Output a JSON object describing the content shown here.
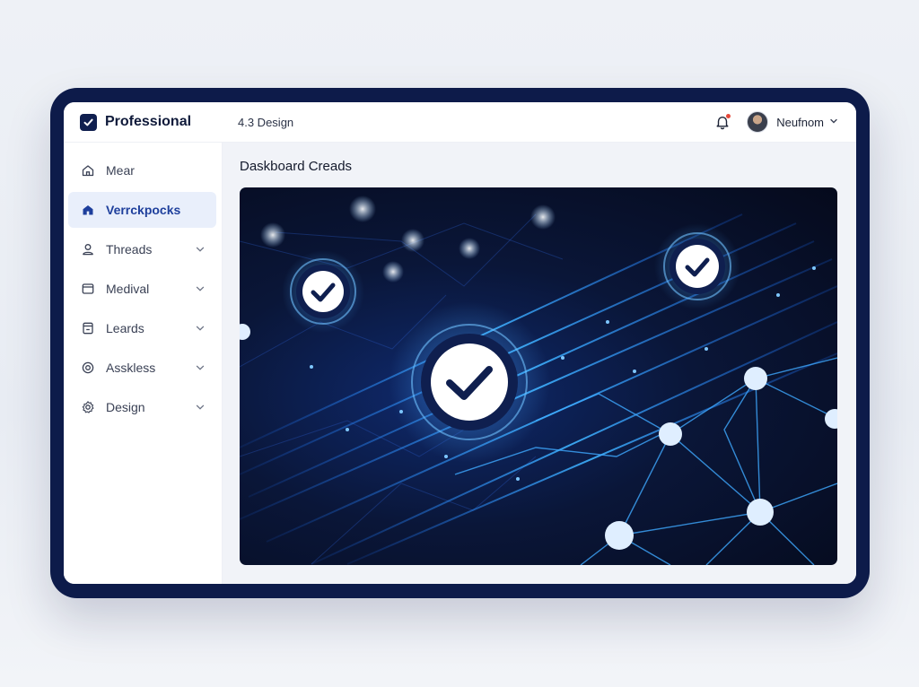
{
  "app": {
    "brand_name": "Professional",
    "version_label": "4.3 Design",
    "user_name": "Neufnom"
  },
  "sidebar": {
    "items": [
      {
        "label": "Mear",
        "icon": "home-icon",
        "active": false,
        "has_chevron": false
      },
      {
        "label": "Verrckpocks",
        "icon": "home-filled-icon",
        "active": true,
        "has_chevron": false
      },
      {
        "label": "Threads",
        "icon": "user-icon",
        "active": false,
        "has_chevron": true
      },
      {
        "label": "Medival",
        "icon": "window-icon",
        "active": false,
        "has_chevron": true
      },
      {
        "label": "Leards",
        "icon": "document-icon",
        "active": false,
        "has_chevron": true
      },
      {
        "label": "Asskless",
        "icon": "target-icon",
        "active": false,
        "has_chevron": true
      },
      {
        "label": "Design",
        "icon": "gear-icon",
        "active": false,
        "has_chevron": true
      }
    ]
  },
  "main": {
    "title": "Daskboard Creads"
  },
  "colors": {
    "frame": "#0d1b4a",
    "accent": "#1e3f9c",
    "active_bg": "#e9effb",
    "notification_dot": "#e5483a"
  }
}
